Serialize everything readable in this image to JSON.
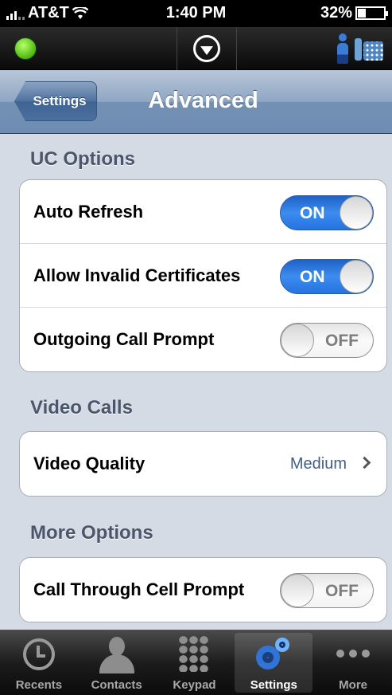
{
  "status_bar": {
    "carrier": "AT&T",
    "time": "1:40 PM",
    "battery_percent": "32%"
  },
  "app_toolbar": {
    "presence_color": "#5cc21a",
    "icons": [
      "presence-dot",
      "dropdown-arrow-icon",
      "person-icon",
      "desk-phone-icon"
    ]
  },
  "nav": {
    "back_label": "Settings",
    "title": "Advanced"
  },
  "sections": {
    "uc_options": {
      "header": "UC Options",
      "rows": [
        {
          "label": "Auto Refresh",
          "toggle": "ON"
        },
        {
          "label": "Allow Invalid Certificates",
          "toggle": "ON"
        },
        {
          "label": "Outgoing Call Prompt",
          "toggle": "OFF"
        }
      ]
    },
    "video_calls": {
      "header": "Video Calls",
      "rows": [
        {
          "label": "Video Quality",
          "value": "Medium"
        }
      ]
    },
    "more_options": {
      "header": "More Options",
      "rows": [
        {
          "label": "Call Through Cell Prompt",
          "toggle": "OFF"
        }
      ]
    }
  },
  "tab_bar": {
    "tabs": [
      {
        "label": "Recents",
        "icon": "clock-icon"
      },
      {
        "label": "Contacts",
        "icon": "contact-icon"
      },
      {
        "label": "Keypad",
        "icon": "keypad-icon"
      },
      {
        "label": "Settings",
        "icon": "gears-icon",
        "active": true
      },
      {
        "label": "More",
        "icon": "more-dots-icon"
      }
    ]
  },
  "colors": {
    "toggle_on": "#2473e0",
    "nav_bar": "#7390b5",
    "background": "#d5dbe5"
  }
}
